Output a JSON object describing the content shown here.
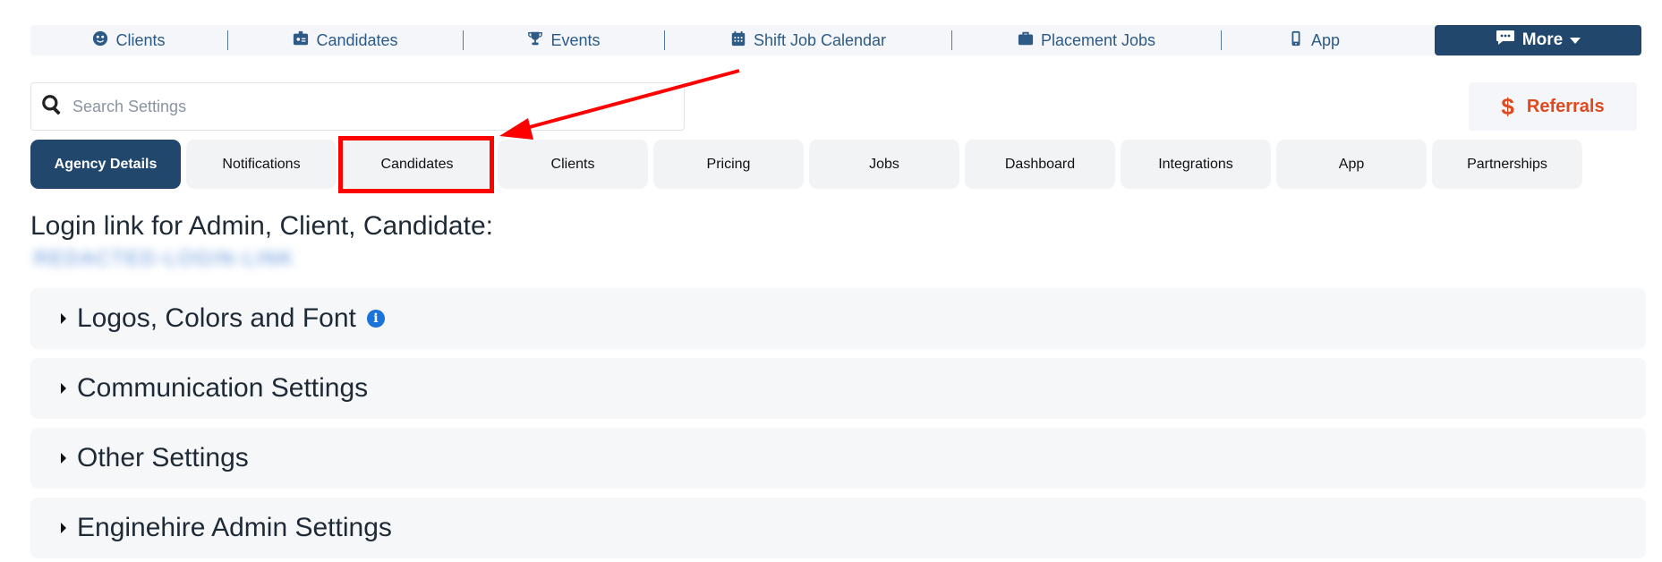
{
  "nav": {
    "items": [
      {
        "label": "Clients",
        "icon": "user-circle-icon"
      },
      {
        "label": "Candidates",
        "icon": "id-badge-icon"
      },
      {
        "label": "Events",
        "icon": "trophy-icon"
      },
      {
        "label": "Shift Job Calendar",
        "icon": "calendar-icon"
      },
      {
        "label": "Placement Jobs",
        "icon": "briefcase-icon"
      },
      {
        "label": "App",
        "icon": "mobile-phone-icon"
      }
    ],
    "more_label": "More",
    "settings_icon": "gear-icon"
  },
  "search": {
    "placeholder": "Search Settings",
    "value": ""
  },
  "referrals": {
    "symbol": "$",
    "label": "Referrals"
  },
  "tabs": [
    {
      "label": "Agency Details",
      "active": true
    },
    {
      "label": "Notifications"
    },
    {
      "label": "Candidates",
      "highlighted": true
    },
    {
      "label": "Clients"
    },
    {
      "label": "Pricing"
    },
    {
      "label": "Jobs"
    },
    {
      "label": "Dashboard"
    },
    {
      "label": "Integrations"
    },
    {
      "label": "App"
    },
    {
      "label": "Partnerships"
    }
  ],
  "login": {
    "title": "Login link for Admin, Client, Candidate:",
    "link": "REDACTED-LOGIN-LINK"
  },
  "sections": [
    {
      "label": "Logos, Colors and Font",
      "info": true
    },
    {
      "label": "Communication Settings"
    },
    {
      "label": "Other Settings"
    },
    {
      "label": "Enginehire Admin Settings"
    }
  ],
  "colors": {
    "brand_navy": "#21476d",
    "nav_text": "#2d5b86",
    "referrals_orange": "#e0491d",
    "annotation_red": "#ff0000",
    "info_blue": "#1a73d9"
  }
}
